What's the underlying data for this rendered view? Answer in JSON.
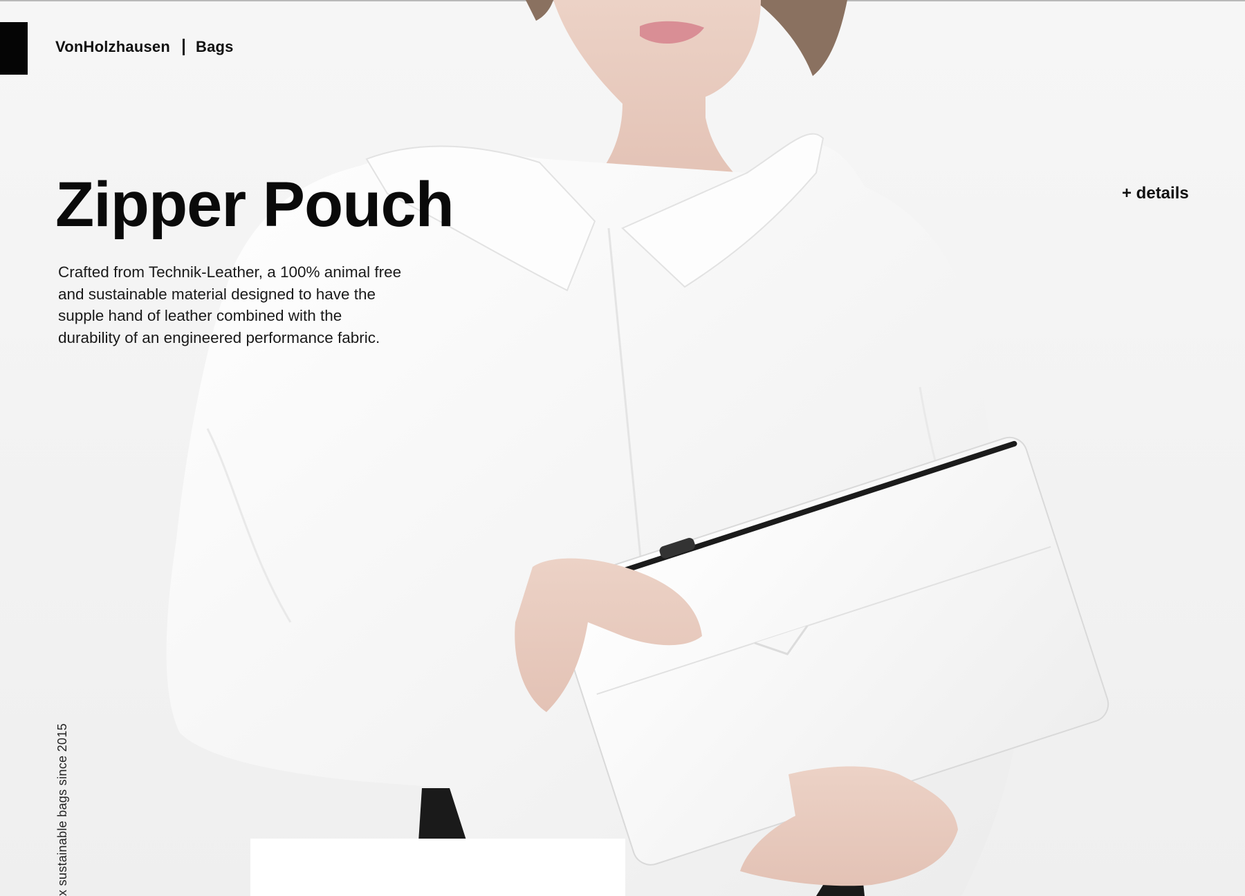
{
  "header": {
    "brand": "VonHolzhausen",
    "category": "Bags"
  },
  "product": {
    "title": "Zipper Pouch",
    "description": "Crafted from Technik-Leather, a 100% animal free and sustainable material designed to have the supple hand of leather combined with the durability of an engineered performance fabric.",
    "details_link": "+ details"
  },
  "side_tagline": "x sustainable bags since 2015",
  "colors": {
    "background": "#f4f4f4",
    "text": "#111111",
    "accent_block": "#050505"
  }
}
